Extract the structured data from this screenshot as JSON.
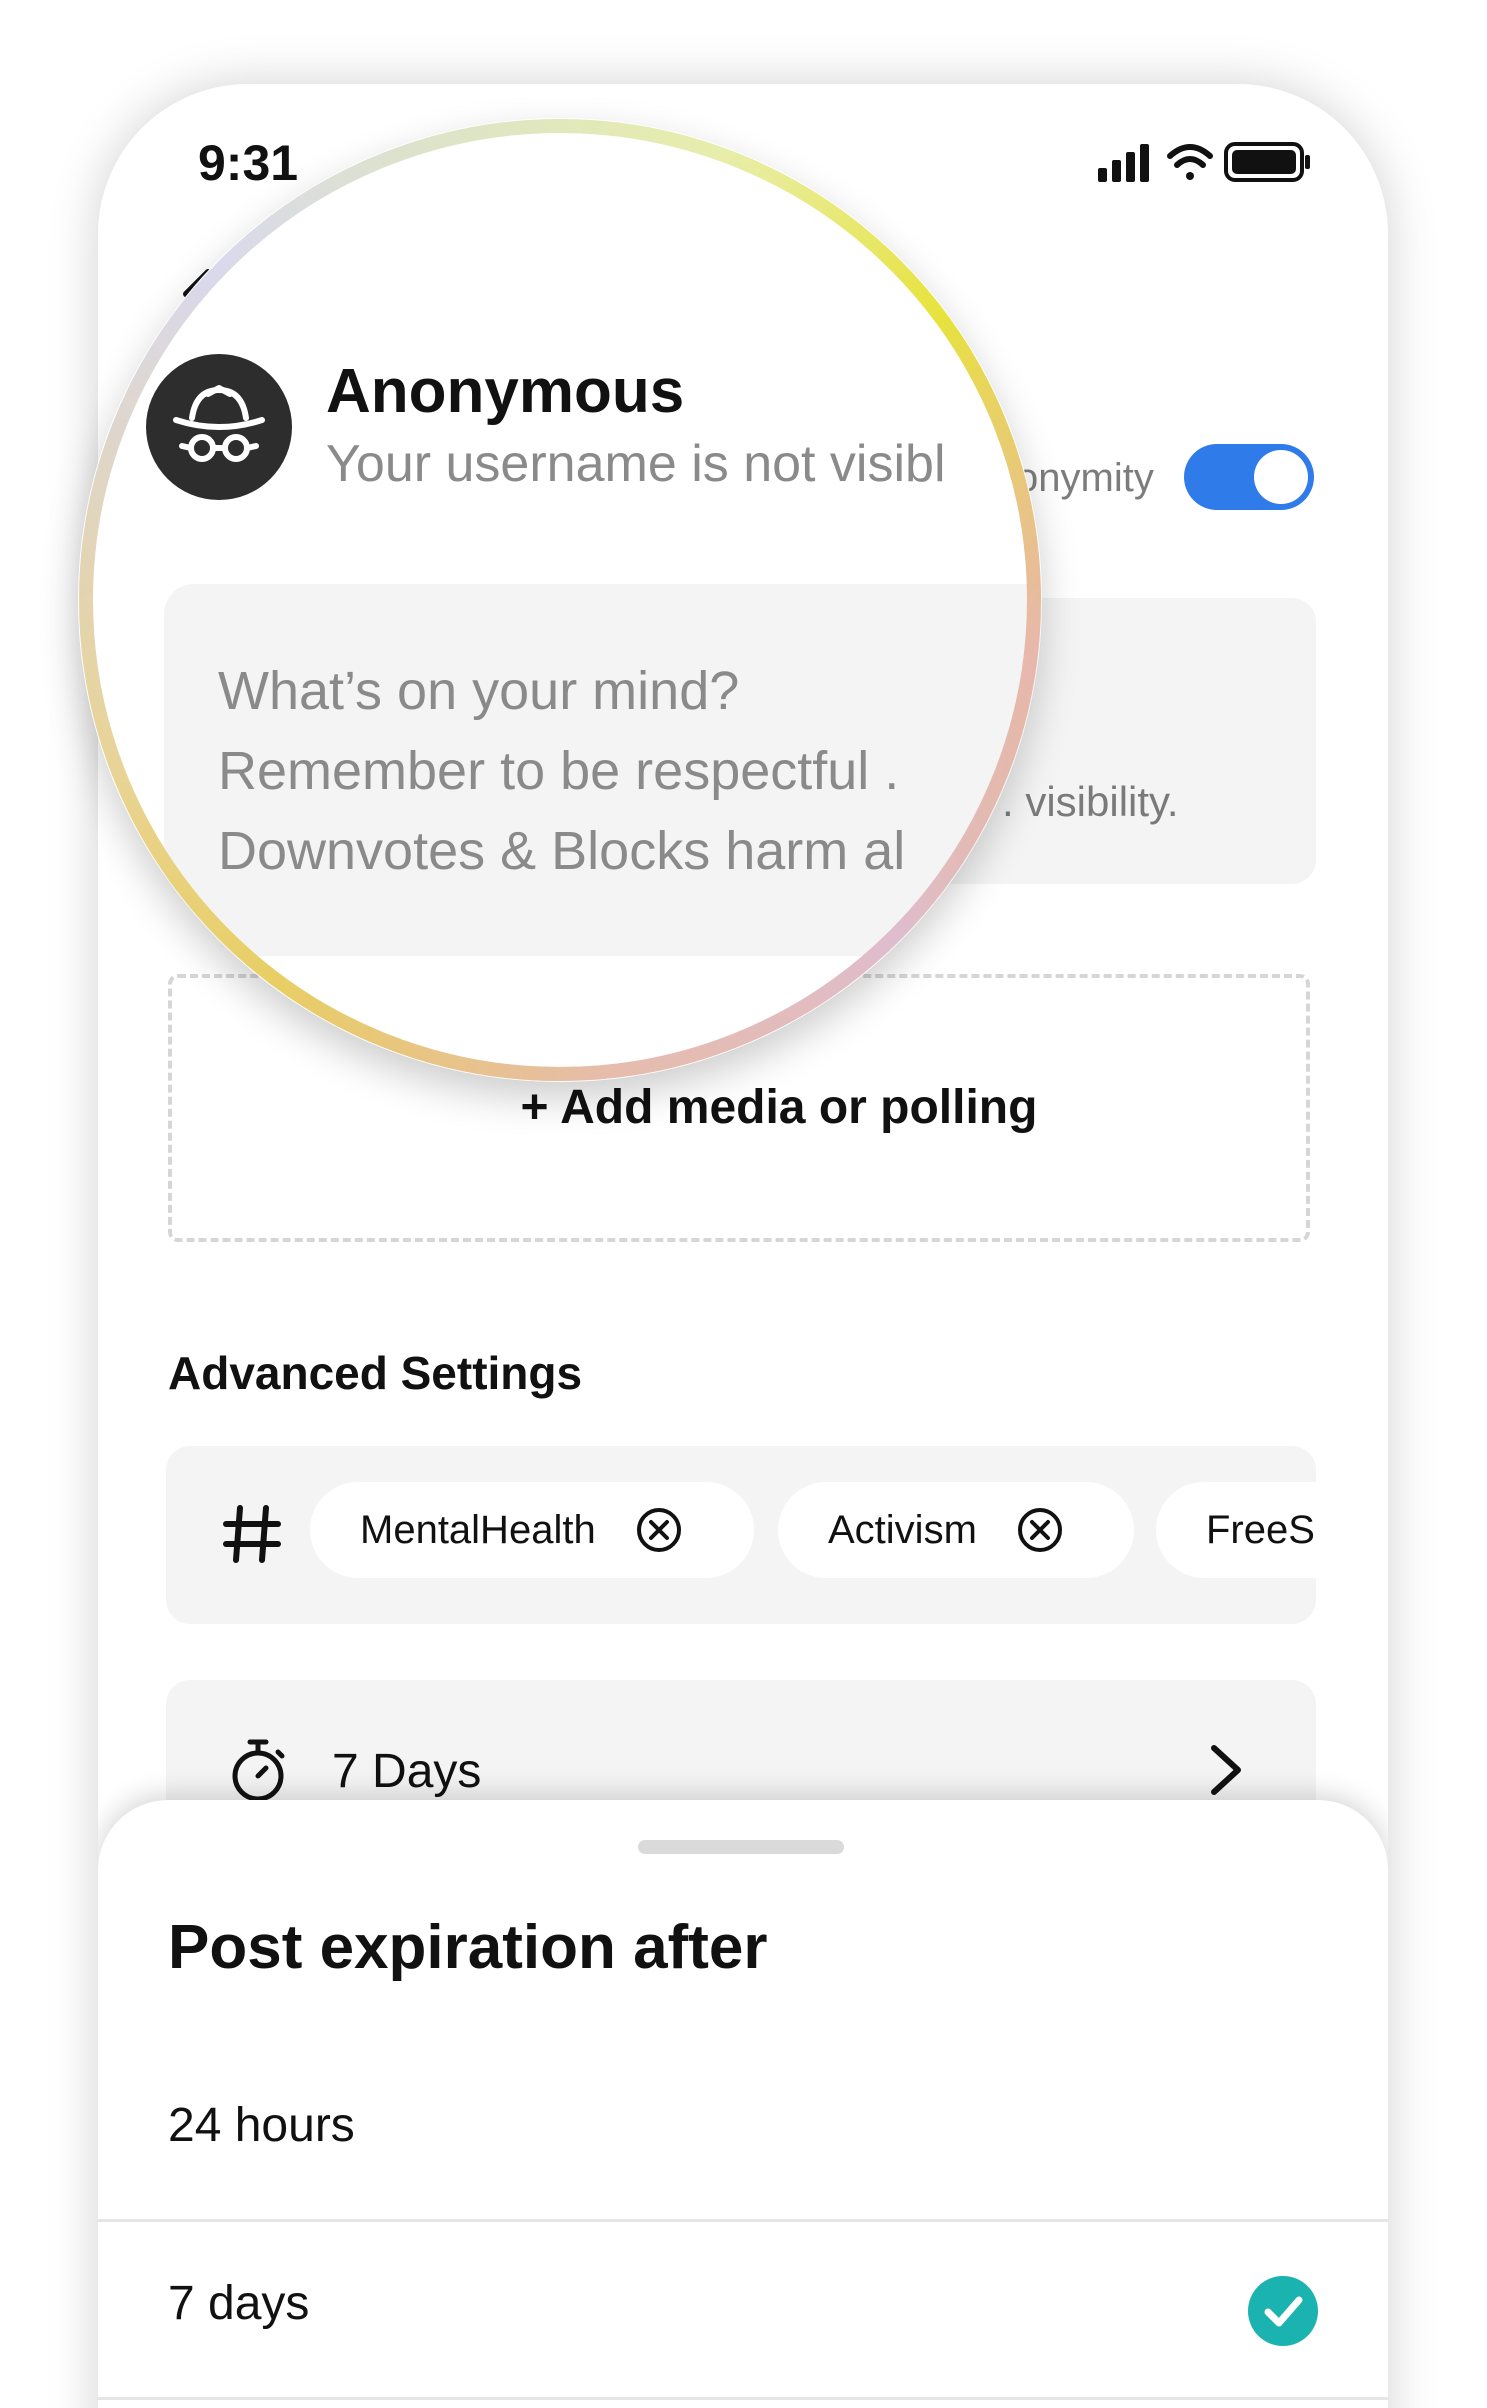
{
  "status_bar": {
    "time": "9:31"
  },
  "profile": {
    "name": "Anonymous",
    "subtitle": "Your username is not visibl",
    "anonymity_label": "onymity",
    "anonymity_on": true
  },
  "compose": {
    "line1": "What’s on your mind?",
    "line2": "Remember to be respectful .",
    "line3": "Downvotes  & Blocks harm al",
    "visibility_hint": ". visibility."
  },
  "media": {
    "label": "+ Add media or polling"
  },
  "advanced": {
    "title": "Advanced Settings",
    "tags": [
      {
        "label": "MentalHealth"
      },
      {
        "label": "Activism"
      },
      {
        "label": "FreeS"
      }
    ],
    "expiration_value": "7 Days"
  },
  "sheet": {
    "title": "Post expiration after",
    "options": [
      {
        "label": "24 hours",
        "selected": false
      },
      {
        "label": "7 days",
        "selected": true
      }
    ]
  },
  "colors": {
    "accent_blue": "#2f7bea",
    "check_teal": "#1bb3b0",
    "avatar_bg": "#2d2d2d"
  },
  "icons": {
    "signal": "signal-icon",
    "wifi": "wifi-icon",
    "battery": "battery-icon",
    "back": "chevron-left-icon",
    "avatar": "incognito-icon",
    "hashtag": "hashtag-icon",
    "close": "close-circle-icon",
    "timer": "stopwatch-icon",
    "chevron": "chevron-right-icon",
    "check": "check-circle-icon"
  }
}
